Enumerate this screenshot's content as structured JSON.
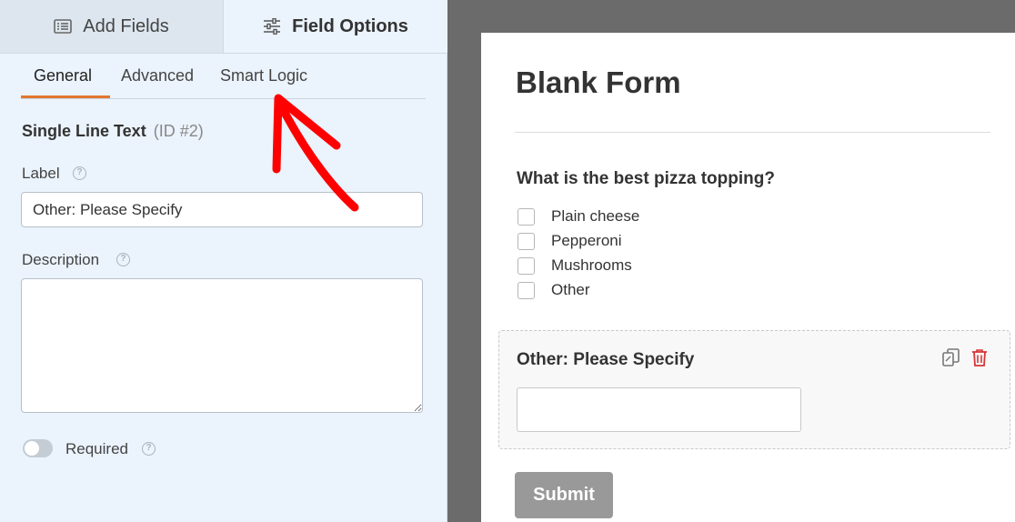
{
  "panel_tabs": {
    "add_fields": "Add Fields",
    "field_options": "Field Options"
  },
  "sub_tabs": {
    "general": "General",
    "advanced": "Advanced",
    "smart_logic": "Smart Logic"
  },
  "field": {
    "type": "Single Line Text",
    "id": "(ID #2)",
    "label_caption": "Label",
    "label_value": "Other: Please Specify",
    "description_caption": "Description",
    "description_value": "",
    "required_caption": "Required",
    "required_on": false
  },
  "help_glyph": "?",
  "form": {
    "title": "Blank Form",
    "question": "What is the best pizza topping?",
    "options": [
      "Plain cheese",
      "Pepperoni",
      "Mushrooms",
      "Other"
    ],
    "other_label": "Other: Please Specify",
    "submit_label": "Submit"
  },
  "colors": {
    "accent_orange": "#e27730",
    "trash_red": "#d63638",
    "annotation_red": "#ff0000"
  },
  "icons": {
    "add_fields": "list-icon",
    "field_options": "sliders-icon",
    "duplicate": "duplicate-icon",
    "delete": "trash-icon"
  }
}
